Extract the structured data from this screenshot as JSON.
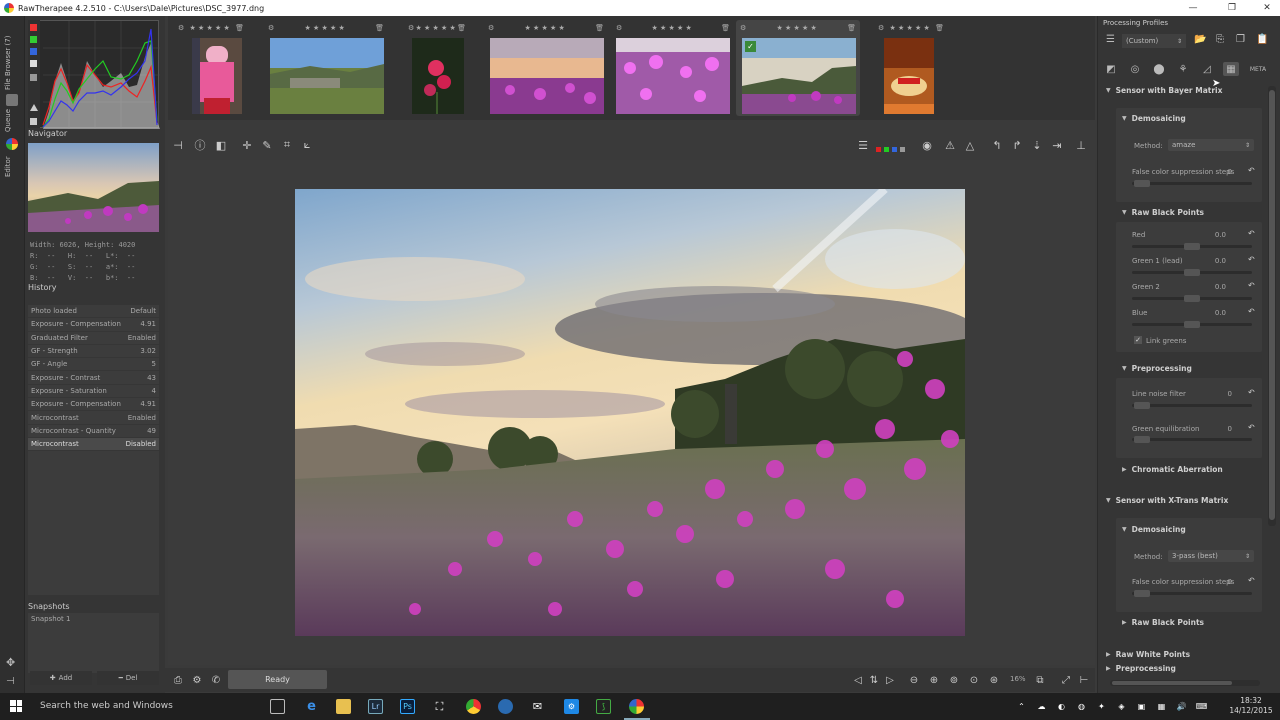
{
  "window": {
    "title": "RawTherapee 4.2.510 - C:\\Users\\Dale\\Pictures\\DSC_3977.dng"
  },
  "left_strip": {
    "tabs": [
      "File Browser (7)",
      "Queue",
      "Editor"
    ]
  },
  "navigator": {
    "title": "Navigator",
    "info_lines": [
      "Width: 6026, Height: 4020",
      "R:  --   H:  --   L*:  --",
      "G:  --   S:  --   a*:  --",
      "B:  --   V:  --   b*:  --"
    ]
  },
  "history": {
    "title": "History",
    "rows": [
      {
        "label": "Photo loaded",
        "value": "Default"
      },
      {
        "label": "Exposure - Compensation",
        "value": "4.91"
      },
      {
        "label": "Graduated Filter",
        "value": "Enabled"
      },
      {
        "label": "GF - Strength",
        "value": "3.02"
      },
      {
        "label": "GF - Angle",
        "value": "5"
      },
      {
        "label": "Exposure - Contrast",
        "value": "43"
      },
      {
        "label": "Exposure - Saturation",
        "value": "4"
      },
      {
        "label": "Exposure - Compensation",
        "value": "4.91"
      },
      {
        "label": "Microcontrast",
        "value": "Enabled"
      },
      {
        "label": "Microcontrast - Quantity",
        "value": "49"
      },
      {
        "label": "Microcontrast",
        "value": "Disabled"
      }
    ]
  },
  "snapshots": {
    "title": "Snapshots",
    "items": [
      "Snapshot 1"
    ],
    "add_label": "Add",
    "del_label": "Del"
  },
  "filmstrip": {
    "thumbs": [
      {
        "stars": "★ ★ ★ ★ ★"
      },
      {
        "stars": "★ ★ ★ ★ ★"
      },
      {
        "stars": "★ ★ ★ ★ ★"
      },
      {
        "stars": "★ ★ ★ ★ ★"
      },
      {
        "stars": "★ ★ ★ ★ ★"
      },
      {
        "stars": "★ ★ ★ ★ ★"
      },
      {
        "stars": "★ ★ ★ ★ ★"
      }
    ]
  },
  "status": {
    "ready": "Ready",
    "zoom": "16%"
  },
  "right_panel": {
    "title": "Processing Profiles",
    "profile": "(Custom)",
    "bayer": {
      "title": "Sensor with Bayer Matrix",
      "demosaicing_title": "Demosaicing",
      "method_label": "Method:",
      "method_value": "amaze",
      "fcs_label": "False color suppression steps",
      "fcs_value": "0",
      "black_points_title": "Raw Black Points",
      "red_label": "Red",
      "red_value": "0.0",
      "green1_label": "Green 1 (lead)",
      "green1_value": "0.0",
      "green2_label": "Green 2",
      "green2_value": "0.0",
      "blue_label": "Blue",
      "blue_value": "0.0",
      "link_greens_label": "Link greens",
      "preprocessing_title": "Preprocessing",
      "line_noise_label": "Line noise filter",
      "line_noise_value": "0",
      "green_eq_label": "Green equilibration",
      "green_eq_value": "0",
      "ca_title": "Chromatic Aberration"
    },
    "xtrans": {
      "title": "Sensor with X-Trans Matrix",
      "demosaicing_title": "Demosaicing",
      "method_label": "Method:",
      "method_value": "3-pass (best)",
      "fcs_label": "False color suppression steps",
      "fcs_value": "0",
      "black_points_title": "Raw Black Points"
    },
    "white_points_title": "Raw White Points",
    "preprocessing_title": "Preprocessing"
  },
  "taskbar": {
    "search": "Search the web and Windows",
    "time": "18:32",
    "date": "14/12/2015"
  }
}
